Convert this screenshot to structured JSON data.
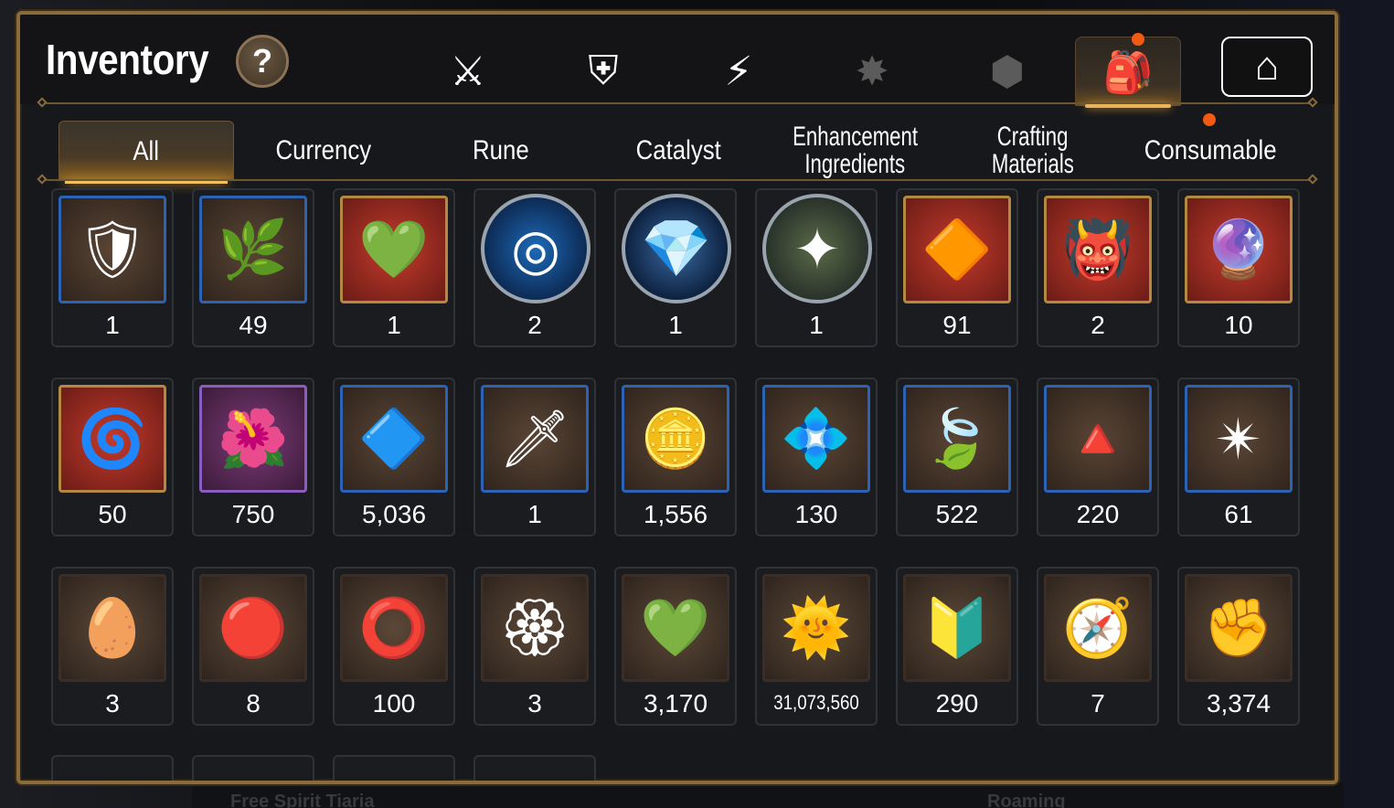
{
  "header": {
    "title": "Inventory",
    "help_label": "?"
  },
  "category_tabs": [
    {
      "icon": "knight-helmet-sword-icon",
      "glyph": "⚔",
      "state": "normal"
    },
    {
      "icon": "broken-shield-icon",
      "glyph": "⛨",
      "state": "normal"
    },
    {
      "icon": "lightning-icon",
      "glyph": "⚡",
      "state": "normal"
    },
    {
      "icon": "spiky-emblem-icon",
      "glyph": "✸",
      "state": "dim"
    },
    {
      "icon": "cube-icon",
      "glyph": "⬢",
      "state": "dim"
    },
    {
      "icon": "backpack-icon",
      "glyph": "🎒",
      "state": "active",
      "notification": true
    },
    {
      "icon": "guild-house-icon",
      "glyph": "⌂",
      "state": "boxed"
    }
  ],
  "sub_tabs": [
    {
      "label": "All",
      "active": true
    },
    {
      "label": "Currency"
    },
    {
      "label": "Rune"
    },
    {
      "label": "Catalyst"
    },
    {
      "label_line1": "Enhancement",
      "label_line2": "Ingredients"
    },
    {
      "label_line1": "Crafting",
      "label_line2": "Materials"
    },
    {
      "label": "Consumable",
      "notification": true
    }
  ],
  "items": [
    {
      "icon": "blue-shield-emblem-icon",
      "glyph": "🛡",
      "frame": "blue",
      "count": "1"
    },
    {
      "icon": "ginseng-root-icon",
      "glyph": "🌿",
      "frame": "blue",
      "count": "49"
    },
    {
      "icon": "green-gem-icon",
      "glyph": "💚",
      "frame": "red",
      "count": "1"
    },
    {
      "icon": "blue-rune-circle-icon",
      "glyph": "◎",
      "frame": "circle c-blue",
      "count": "2"
    },
    {
      "icon": "blue-crystal-orb-icon",
      "glyph": "💎",
      "frame": "circle c-dark",
      "count": "1"
    },
    {
      "icon": "pink-star-gem-icon",
      "glyph": "✦",
      "frame": "circle c-green",
      "count": "1"
    },
    {
      "icon": "golden-crystal-icon",
      "glyph": "🔶",
      "frame": "red",
      "count": "91"
    },
    {
      "icon": "tribal-mask-icon",
      "glyph": "👹",
      "frame": "red",
      "count": "2"
    },
    {
      "icon": "purple-disc-icon",
      "glyph": "🔮",
      "frame": "red",
      "count": "10"
    },
    {
      "icon": "coiled-amulet-icon",
      "glyph": "🌀",
      "frame": "red",
      "count": "50"
    },
    {
      "icon": "flower-ring-icon",
      "glyph": "🌺",
      "frame": "purple",
      "count": "750"
    },
    {
      "icon": "blue-diamond-icon",
      "glyph": "🔷",
      "frame": "blue",
      "count": "5,036"
    },
    {
      "icon": "pocket-watch-blade-icon",
      "glyph": "🗡",
      "frame": "blue",
      "count": "1"
    },
    {
      "icon": "silver-coin-icon",
      "glyph": "🪙",
      "frame": "blue",
      "count": "1,556"
    },
    {
      "icon": "teal-crystal-icon",
      "glyph": "💠",
      "frame": "blue",
      "count": "130"
    },
    {
      "icon": "green-leaf-icon",
      "glyph": "🍃",
      "frame": "blue",
      "count": "522"
    },
    {
      "icon": "pink-crystal-cluster-icon",
      "glyph": "🔺",
      "frame": "blue",
      "count": "220"
    },
    {
      "icon": "star-amulet-icon",
      "glyph": "✴",
      "frame": "blue",
      "count": "61"
    },
    {
      "icon": "egg-device-icon",
      "glyph": "🥚",
      "frame": "brown",
      "count": "3"
    },
    {
      "icon": "fire-orb-icon",
      "glyph": "🔴",
      "frame": "brown",
      "count": "8"
    },
    {
      "icon": "red-bracelet-icon",
      "glyph": "⭕",
      "frame": "brown",
      "count": "100"
    },
    {
      "icon": "red-seal-badge-icon",
      "glyph": "🏵",
      "frame": "brown",
      "count": "3"
    },
    {
      "icon": "green-heart-icon",
      "glyph": "💚",
      "frame": "brown",
      "count": "3,170"
    },
    {
      "icon": "sun-coin-icon",
      "glyph": "🌞",
      "frame": "brown",
      "count": "31,073,560",
      "small": true
    },
    {
      "icon": "golden-hex-badge-icon",
      "glyph": "🔰",
      "frame": "brown",
      "count": "290"
    },
    {
      "icon": "stone-compass-icon",
      "glyph": "🧭",
      "frame": "brown",
      "count": "7"
    },
    {
      "icon": "fist-emblem-icon",
      "glyph": "✊",
      "frame": "brown",
      "count": "3,374"
    }
  ],
  "background": {
    "text_left": "Free Spirit Tiaria",
    "text_right": "Roaming"
  }
}
